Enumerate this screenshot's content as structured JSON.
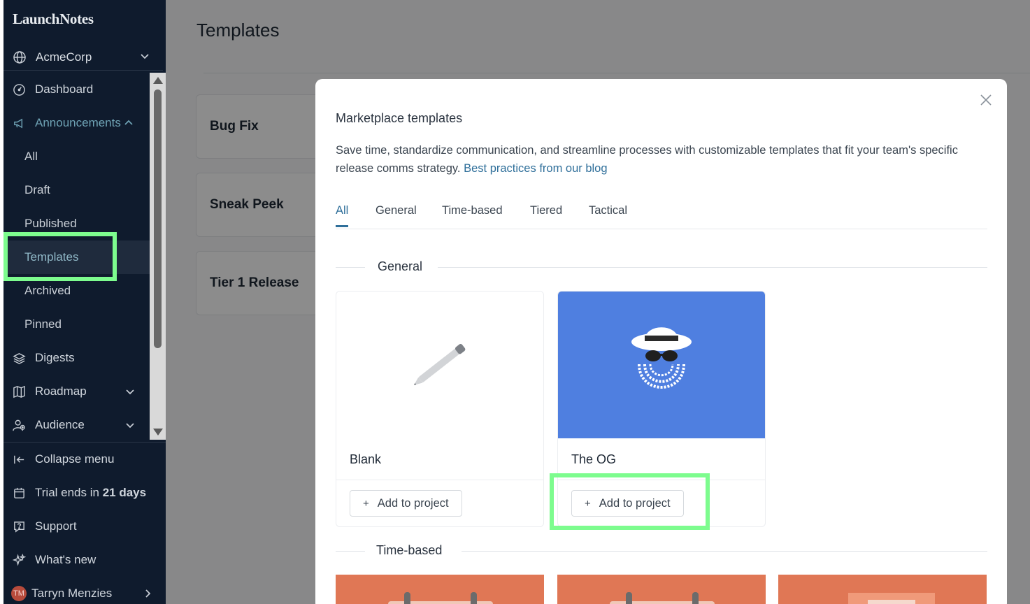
{
  "app": {
    "logo": "LaunchNotes"
  },
  "sidebar": {
    "org": {
      "label": "AcmeCorp",
      "icon": "globe-icon"
    },
    "items": [
      {
        "label": "Dashboard",
        "icon": "dashboard-icon"
      },
      {
        "label": "Announcements",
        "icon": "megaphone-icon"
      },
      {
        "label": "All"
      },
      {
        "label": "Draft"
      },
      {
        "label": "Published"
      },
      {
        "label": "Templates"
      },
      {
        "label": "Archived"
      },
      {
        "label": "Pinned"
      },
      {
        "label": "Digests",
        "icon": "layers-icon"
      },
      {
        "label": "Roadmap",
        "icon": "map-icon"
      },
      {
        "label": "Audience",
        "icon": "users-icon"
      }
    ],
    "bottom": {
      "collapse": "Collapse menu",
      "trial_prefix": "Trial ends in",
      "trial_days": "21 days",
      "support": "Support",
      "whats_new": "What's new",
      "user_initials": "TM",
      "user_name": "Tarryn Menzies"
    }
  },
  "page": {
    "title": "Templates",
    "cards": [
      "Bug Fix",
      "Sneak Peek",
      "Tier 1 Release"
    ]
  },
  "modal": {
    "title": "Marketplace templates",
    "description": "Save time, standardize communication, and streamline processes with customizable templates that fit your team's specific release comms strategy.",
    "blog_link": "Best practices from our blog",
    "tabs": [
      "All",
      "General",
      "Time-based",
      "Tiered",
      "Tactical"
    ],
    "active_tab": "All",
    "sections": [
      {
        "label": "General",
        "templates": [
          {
            "name": "Blank",
            "button": "Add to project"
          },
          {
            "name": "The OG",
            "button": "Add to project",
            "thumb_color": "#4f7fe0"
          }
        ]
      },
      {
        "label": "Time-based",
        "thumb_color": "#e07755"
      }
    ]
  },
  "colors": {
    "sidebar_bg": "#0f1b2d",
    "accent": "#2f6f9a",
    "highlight": "#7dfc8e"
  }
}
